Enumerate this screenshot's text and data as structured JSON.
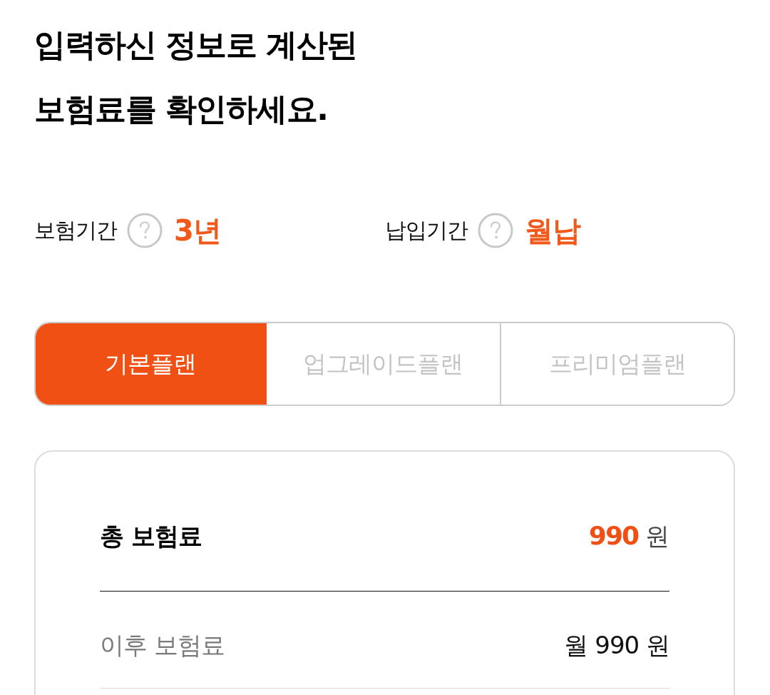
{
  "heading": [
    "입력하신 정보로 계산된",
    "보험료를 확인하세요."
  ],
  "terms": [
    {
      "label": "보험기간",
      "value": "3년"
    },
    {
      "label": "납입기간",
      "value": "월납"
    }
  ],
  "plans": [
    {
      "label": "기본플랜",
      "selected": true
    },
    {
      "label": "업그레이드플랜",
      "selected": false
    },
    {
      "label": "프리미엄플랜",
      "selected": false
    }
  ],
  "summary": [
    {
      "kind": "total",
      "label": "총 보험료",
      "amount": "990",
      "unit": "원"
    },
    {
      "kind": "after",
      "label": "이후 보험료",
      "value": "월 990 원"
    }
  ]
}
